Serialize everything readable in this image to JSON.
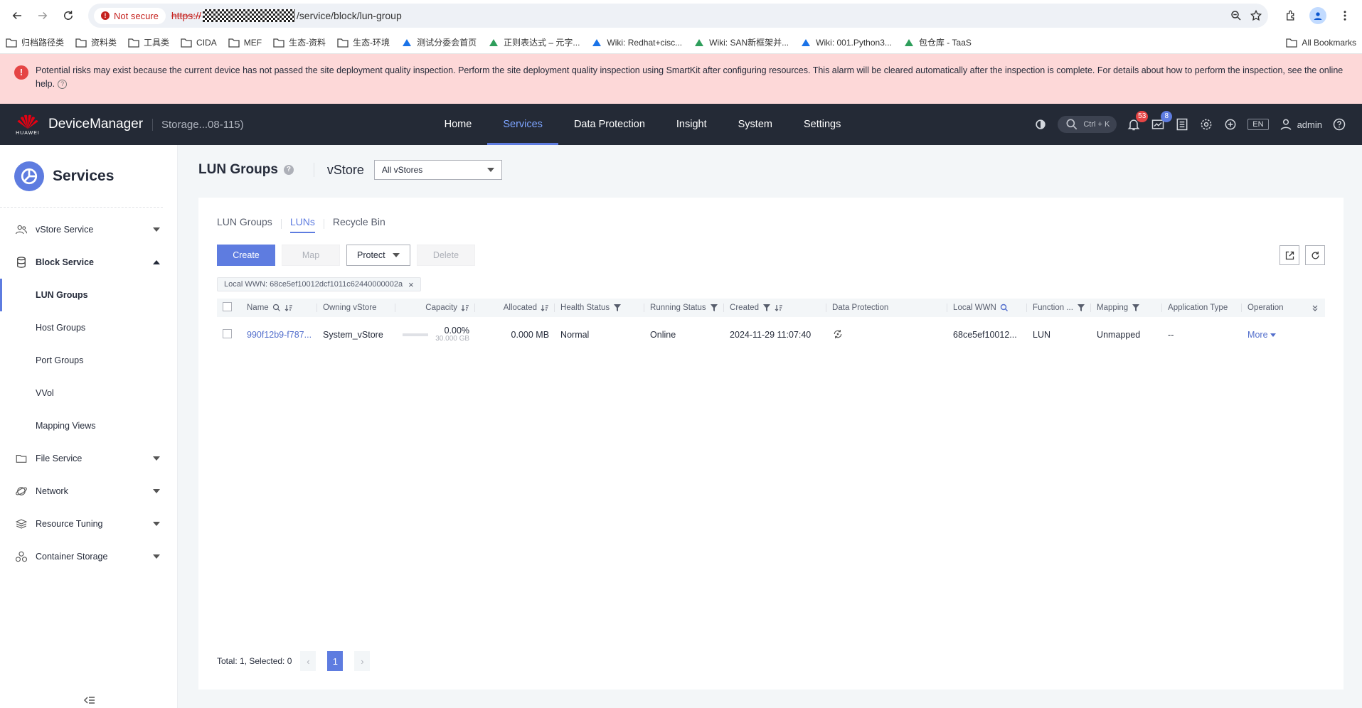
{
  "browser": {
    "security_label": "Not secure",
    "url_protocol": "https://",
    "url_path": "/service/block/lun-group",
    "bookmarks": [
      "归档路径类",
      "资料类",
      "工具类",
      "CIDA",
      "MEF",
      "生态-资料",
      "生态-环境",
      "测试分委会首页",
      "正则表达式 – 元字...",
      "Wiki: Redhat+cisc...",
      "Wiki: SAN新框架并...",
      "Wiki: 001.Python3...",
      "包仓库 - TaaS"
    ],
    "all_bookmarks": "All Bookmarks"
  },
  "alert": {
    "text": "Potential risks may exist because the current device has not passed the site deployment quality inspection. Perform the site deployment quality inspection using SmartKit after configuring resources. This alarm will be cleared automatically after the inspection is complete. For details about how to perform the inspection, see the online help."
  },
  "header": {
    "brand": "HUAWEI",
    "app_name": "DeviceManager",
    "device_name": "Storage...08-115)",
    "nav": [
      "Home",
      "Services",
      "Data Protection",
      "Insight",
      "System",
      "Settings"
    ],
    "active_nav": "Services",
    "search_shortcut": "Ctrl + K",
    "alarm_count": "53",
    "task_count": "8",
    "language": "EN",
    "user": "admin"
  },
  "sidebar": {
    "title": "Services",
    "items": [
      {
        "label": "vStore Service"
      },
      {
        "label": "Block Service"
      },
      {
        "label": "File Service"
      },
      {
        "label": "Network"
      },
      {
        "label": "Resource Tuning"
      },
      {
        "label": "Container Storage"
      }
    ],
    "block_sub": [
      "LUN Groups",
      "Host Groups",
      "Port Groups",
      "VVol",
      "Mapping Views"
    ]
  },
  "content": {
    "title": "LUN Groups",
    "vstore_label": "vStore",
    "vstore_value": "All vStores",
    "tabs": [
      "LUN Groups",
      "LUNs",
      "Recycle Bin"
    ],
    "active_tab": "LUNs",
    "buttons": {
      "create": "Create",
      "map": "Map",
      "protect": "Protect",
      "delete": "Delete"
    },
    "filter_tag": "Local WWN: 68ce5ef10012dcf1011c62440000002a",
    "columns": [
      "Name",
      "Owning vStore",
      "Capacity",
      "Allocated",
      "Health Status",
      "Running Status",
      "Created",
      "Data Protection",
      "Local WWN",
      "Function ...",
      "Mapping",
      "Application Type",
      "Operation"
    ],
    "row": {
      "name": "990f12b9-f787...",
      "vstore": "System_vStore",
      "capacity_pct": "0.00%",
      "capacity_total": "30.000 GB",
      "allocated": "0.000 MB",
      "health": "Normal",
      "running": "Online",
      "created": "2024-11-29 11:07:40",
      "wwn": "68ce5ef10012...",
      "function": "LUN",
      "mapping": "Unmapped",
      "app_type": "--",
      "operation": "More"
    },
    "pager": {
      "summary": "Total: 1, Selected: 0",
      "page": "1"
    }
  },
  "colors": {
    "accent": "#5e7ce0",
    "header_bg": "#242a36",
    "alert_bg": "#fdd8d8",
    "danger": "#e54545"
  }
}
